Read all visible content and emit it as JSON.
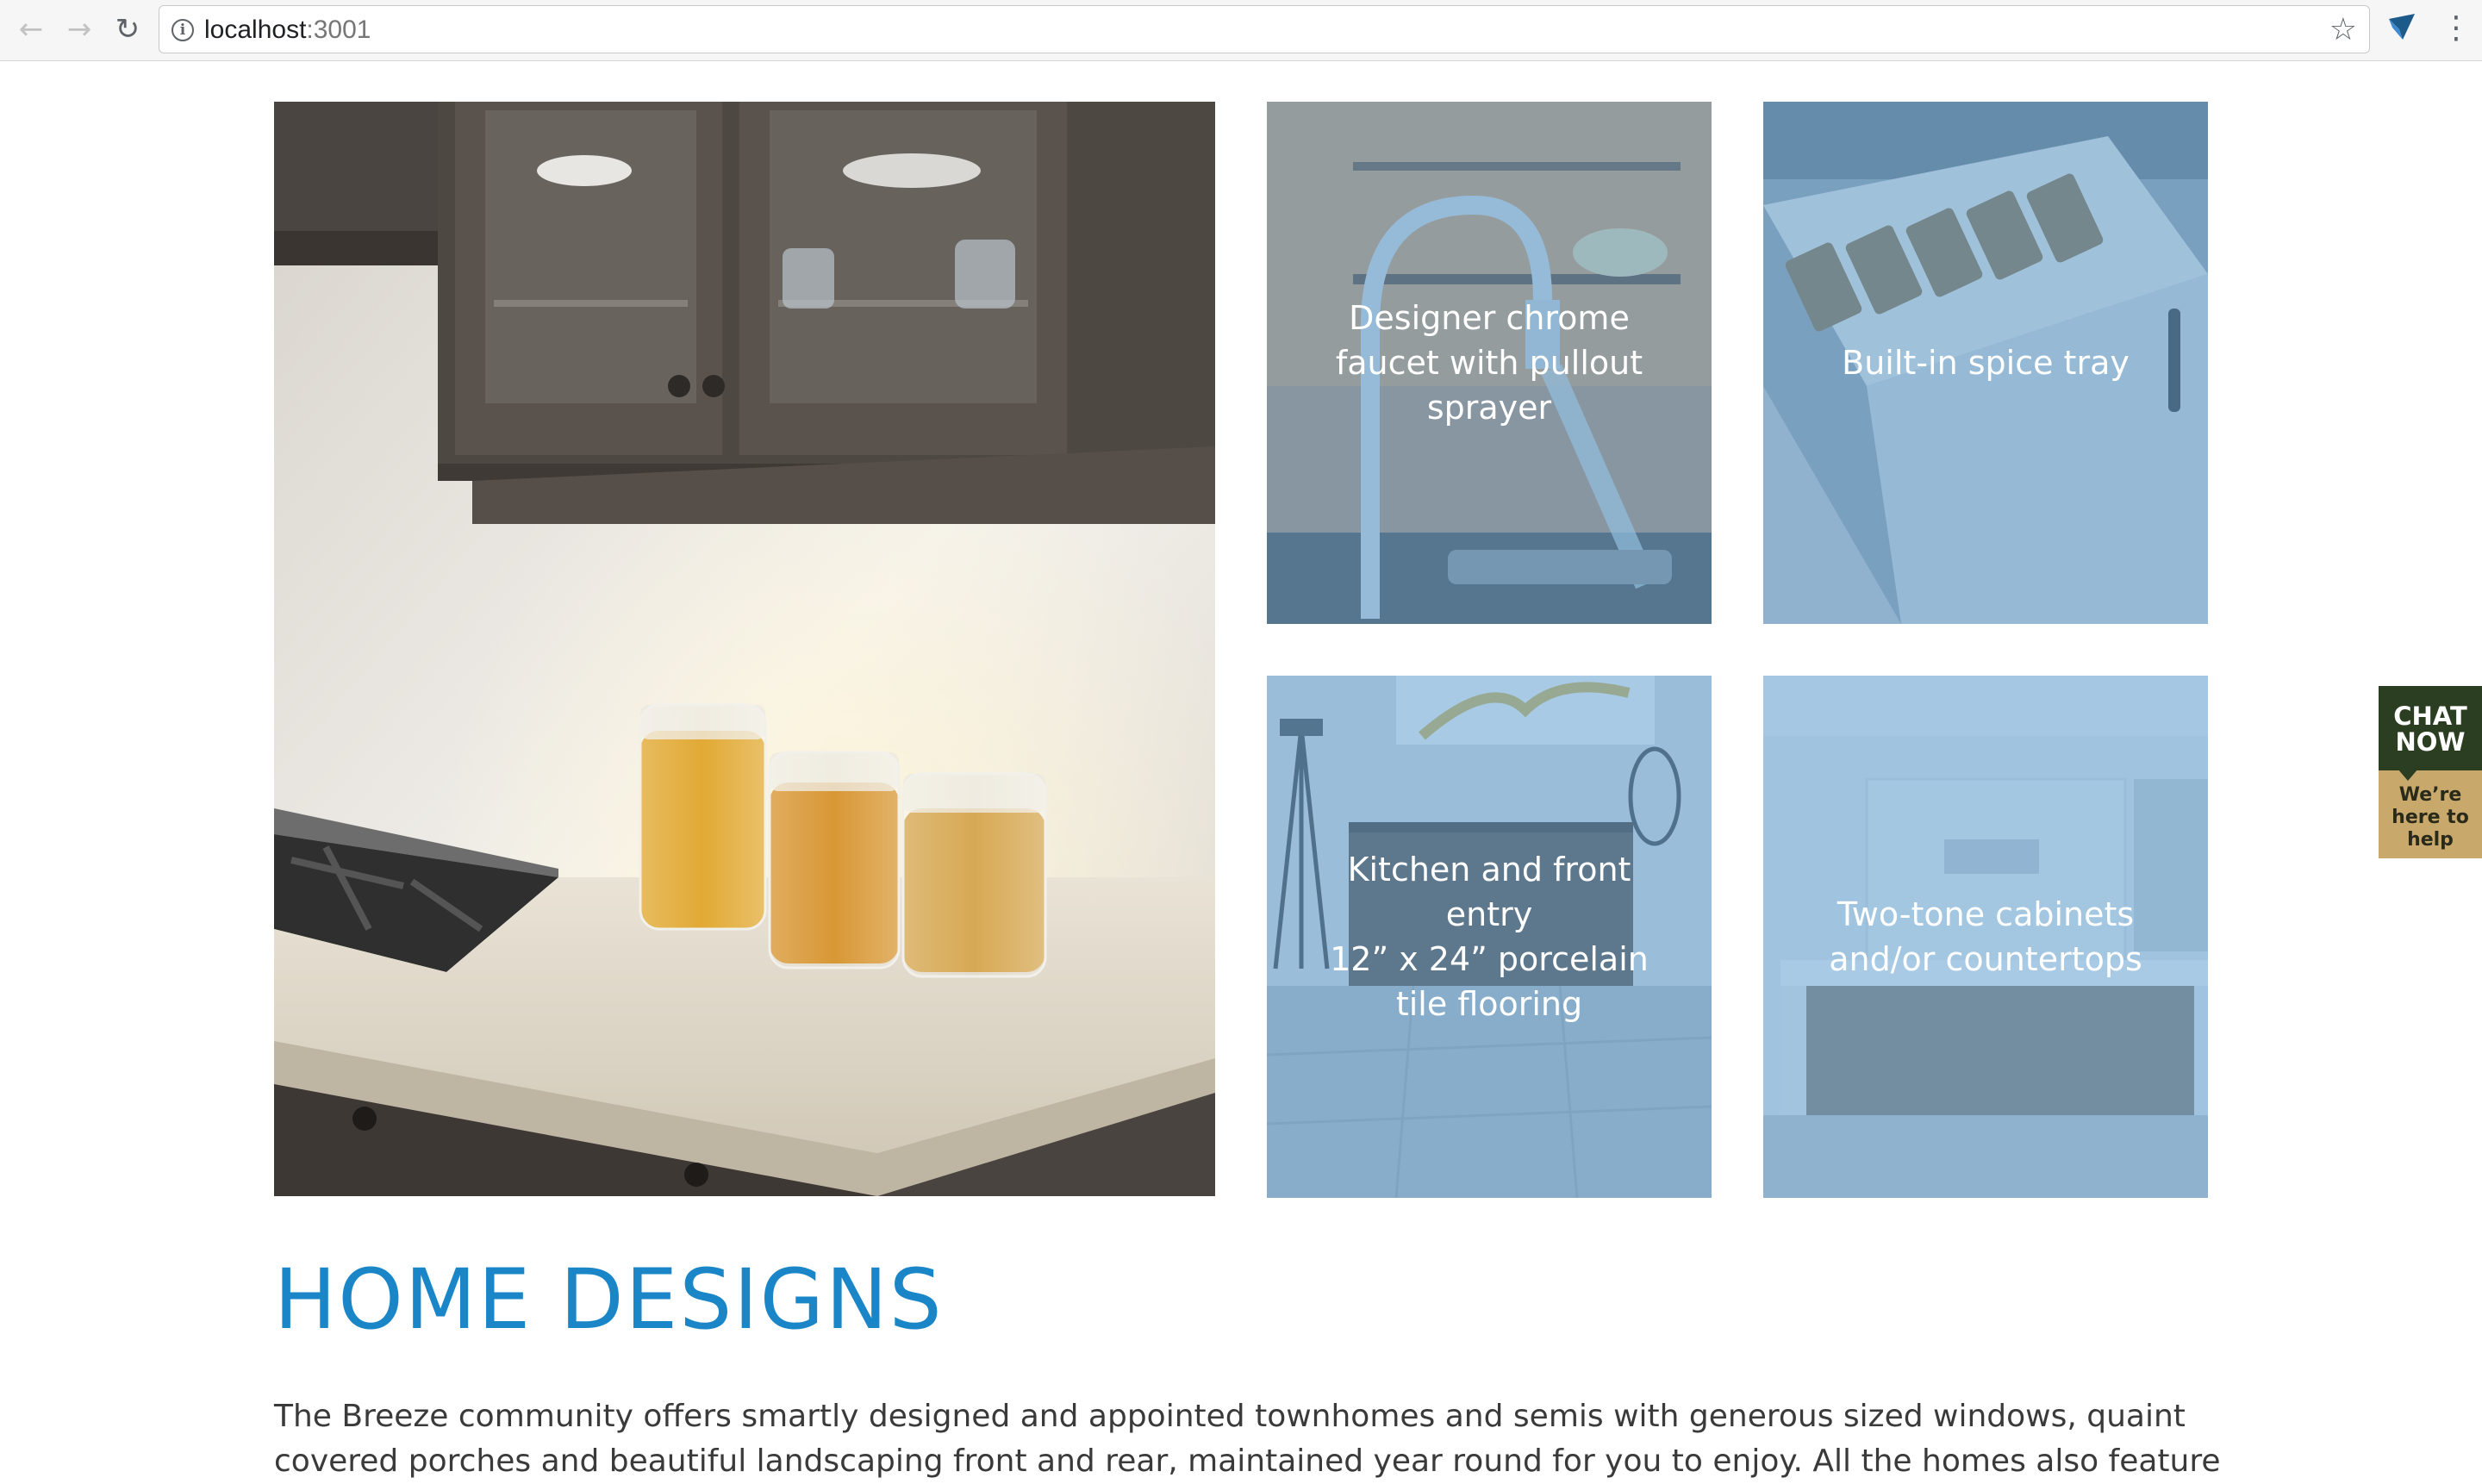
{
  "browser": {
    "url_host": "localhost",
    "url_port": ":3001",
    "back_icon": "arrow-left",
    "forward_icon": "arrow-right",
    "reload_icon": "reload",
    "info_icon": "info-circle",
    "bookmark_icon": "star-outline",
    "menu_icon": "vertical-ellipsis"
  },
  "features": [
    {
      "caption": "Designer chrome\nfaucet with pullout\nsprayer"
    },
    {
      "caption": "Built-in spice tray"
    },
    {
      "caption": "Kitchen and front entry\n12” x 24” porcelain\ntile flooring"
    },
    {
      "caption": "Two-tone cabinets\nand/or countertops"
    }
  ],
  "section": {
    "title": "HOME DESIGNS",
    "body": "The Breeze community offers smartly designed and appointed townhomes and semis with generous sized windows, quaint covered porches and beautiful landscaping front and rear, maintained year round for you to enjoy. All the homes also feature"
  },
  "chat": {
    "title_line1": "CHAT",
    "title_line2": "NOW",
    "sub_line1": "We’re",
    "sub_line2": "here to",
    "sub_line3": "help"
  },
  "colors": {
    "heading": "#1a86c8",
    "overlay": "#609ed0",
    "chat_dark": "#2c3e22",
    "chat_gold": "#c8a96b"
  }
}
